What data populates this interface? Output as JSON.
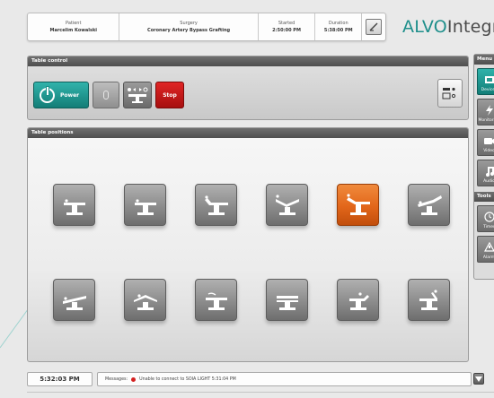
{
  "header": {
    "patient_label": "Patient",
    "patient_value": "Marcelim Kowalski",
    "surgery_label": "Surgery",
    "surgery_value": "Coronary Artery Bypass Grafting",
    "started_label": "Started",
    "started_value": "2:50:00 PM",
    "duration_label": "Duration",
    "duration_value": "5:38:00 PM",
    "toggle_icon": "diagonal-switch-icon"
  },
  "brand": {
    "part1": "ALVO",
    "part2": "Integr",
    "color": "#1e8f8b"
  },
  "table_control": {
    "title": "Table control",
    "power_label": "Power",
    "stop_label": "Stop",
    "power_color": "#137d77",
    "stop_color": "#c01515"
  },
  "table_positions": {
    "title": "Table positions",
    "active_color": "#e2661a",
    "tiles": [
      {
        "icon": "table-flat-icon",
        "active": false
      },
      {
        "icon": "table-flat-icon",
        "active": false
      },
      {
        "icon": "table-trendelenburg-icon",
        "active": false
      },
      {
        "icon": "table-flex-icon",
        "active": false
      },
      {
        "icon": "table-beach-chair-icon",
        "active": true
      },
      {
        "icon": "table-reverse-flex-icon",
        "active": false
      },
      {
        "icon": "table-tilt-left-icon",
        "active": false
      },
      {
        "icon": "table-lateral-icon",
        "active": false
      },
      {
        "icon": "table-prone-icon",
        "active": false
      },
      {
        "icon": "table-level-icon",
        "active": false
      },
      {
        "icon": "table-lithotomy-icon",
        "active": false
      },
      {
        "icon": "table-seated-icon",
        "active": false
      }
    ]
  },
  "sidebar": {
    "menu_title": "Menu",
    "tools_title": "Tools",
    "items": [
      {
        "label": "Devices",
        "icon": "devices-icon",
        "active": true
      },
      {
        "label": "Monitoring",
        "icon": "lightning-icon",
        "active": false
      },
      {
        "label": "Video",
        "icon": "camera-icon",
        "active": false
      },
      {
        "label": "Audio",
        "icon": "music-note-icon",
        "active": false
      }
    ],
    "tools": [
      {
        "label": "Timer",
        "icon": "timer-icon"
      },
      {
        "label": "Alarm",
        "icon": "alarm-icon"
      }
    ]
  },
  "footer": {
    "time": "5:32:03 PM",
    "messages_label": "Messages:",
    "message": "Unable to connect to SOIA LIGHT 5:31:04 PM"
  }
}
